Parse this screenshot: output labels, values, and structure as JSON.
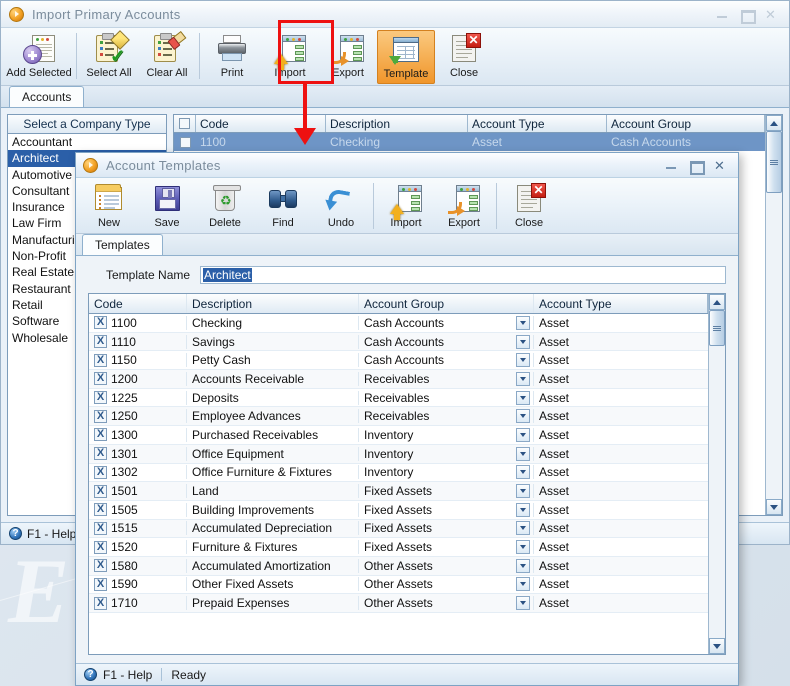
{
  "main_window": {
    "title": "Import Primary Accounts",
    "window_controls": {
      "minimize": "minimize-icon",
      "maximize": "maximize-icon",
      "close": "close-icon"
    },
    "toolbar": [
      {
        "label": "Add Selected",
        "icon": "add-selected-icon"
      },
      {
        "label": "Select All",
        "icon": "select-all-icon"
      },
      {
        "label": "Clear All",
        "icon": "clear-all-icon"
      },
      {
        "label": "Print",
        "icon": "printer-icon"
      },
      {
        "label": "Import",
        "icon": "import-icon"
      },
      {
        "label": "Export",
        "icon": "export-icon"
      },
      {
        "label": "Template",
        "icon": "template-icon"
      },
      {
        "label": "Close",
        "icon": "close-document-icon"
      }
    ],
    "tabs": [
      {
        "label": "Accounts",
        "active": true
      }
    ],
    "company_panel": {
      "header": "Select a Company Type",
      "items": [
        "Accountant",
        "Architect",
        "Automotive",
        "Consultant",
        "Insurance",
        "Law Firm",
        "Manufacturing",
        "Non-Profit",
        "Real Estate",
        "Restaurant",
        "Retail",
        "Software",
        "Wholesale"
      ],
      "selected": "Architect"
    },
    "accounts_grid": {
      "columns": [
        "Code",
        "Description",
        "Account Type",
        "Account Group"
      ],
      "rows": [
        {
          "code": "1100",
          "description": "Checking",
          "account_type": "Asset",
          "account_group": "Cash Accounts",
          "selected": true
        }
      ]
    },
    "status_bar": {
      "help": "F1 - Help"
    }
  },
  "dialog": {
    "title": "Account Templates",
    "window_controls": {
      "minimize": "minimize-icon",
      "maximize": "maximize-icon",
      "close": "close-icon"
    },
    "toolbar": [
      {
        "label": "New",
        "icon": "new-folder-icon"
      },
      {
        "label": "Save",
        "icon": "floppy-disk-icon"
      },
      {
        "label": "Delete",
        "icon": "trash-bin-icon"
      },
      {
        "label": "Find",
        "icon": "binoculars-icon"
      },
      {
        "label": "Undo",
        "icon": "undo-arrow-icon"
      },
      {
        "label": "Import",
        "icon": "import-icon"
      },
      {
        "label": "Export",
        "icon": "export-icon"
      },
      {
        "label": "Close",
        "icon": "close-document-icon"
      }
    ],
    "tabs": [
      {
        "label": "Templates",
        "active": true
      }
    ],
    "form": {
      "template_name_label": "Template Name",
      "template_name_value": "Architect"
    },
    "grid": {
      "columns": [
        "Code",
        "Description",
        "Account Group",
        "Account Type"
      ],
      "rows": [
        {
          "code": "1100",
          "description": "Checking",
          "account_group": "Cash Accounts",
          "account_type": "Asset"
        },
        {
          "code": "1110",
          "description": "Savings",
          "account_group": "Cash Accounts",
          "account_type": "Asset"
        },
        {
          "code": "1150",
          "description": "Petty Cash",
          "account_group": "Cash Accounts",
          "account_type": "Asset"
        },
        {
          "code": "1200",
          "description": "Accounts Receivable",
          "account_group": "Receivables",
          "account_type": "Asset"
        },
        {
          "code": "1225",
          "description": "Deposits",
          "account_group": "Receivables",
          "account_type": "Asset"
        },
        {
          "code": "1250",
          "description": "Employee Advances",
          "account_group": "Receivables",
          "account_type": "Asset"
        },
        {
          "code": "1300",
          "description": "Purchased Receivables",
          "account_group": "Inventory",
          "account_type": "Asset"
        },
        {
          "code": "1301",
          "description": "Office Equipment",
          "account_group": "Inventory",
          "account_type": "Asset"
        },
        {
          "code": "1302",
          "description": "Office Furniture & Fixtures",
          "account_group": "Inventory",
          "account_type": "Asset"
        },
        {
          "code": "1501",
          "description": "Land",
          "account_group": "Fixed Assets",
          "account_type": "Asset"
        },
        {
          "code": "1505",
          "description": "Building Improvements",
          "account_group": "Fixed Assets",
          "account_type": "Asset"
        },
        {
          "code": "1515",
          "description": "Accumulated Depreciation",
          "account_group": "Fixed Assets",
          "account_type": "Asset"
        },
        {
          "code": "1520",
          "description": "Furniture & Fixtures",
          "account_group": "Fixed Assets",
          "account_type": "Asset"
        },
        {
          "code": "1580",
          "description": "Accumulated Amortization",
          "account_group": "Other Assets",
          "account_type": "Asset"
        },
        {
          "code": "1590",
          "description": "Other Fixed Assets",
          "account_group": "Other Assets",
          "account_type": "Asset"
        },
        {
          "code": "1710",
          "description": "Prepaid Expenses",
          "account_group": "Other Assets",
          "account_type": "Asset"
        }
      ],
      "row_delete_glyph": "X"
    },
    "status_bar": {
      "help": "F1 - Help",
      "state": "Ready"
    }
  },
  "desktop": {
    "watermark": "E"
  },
  "annotation": {
    "color": "#ee1111",
    "target": "Template"
  },
  "colors": {
    "selection_blue": "#2b5fa8",
    "highlight_orange": "#f0962b",
    "annotation_red": "#ee1111",
    "titlebar_text": "#7b8c9c"
  }
}
